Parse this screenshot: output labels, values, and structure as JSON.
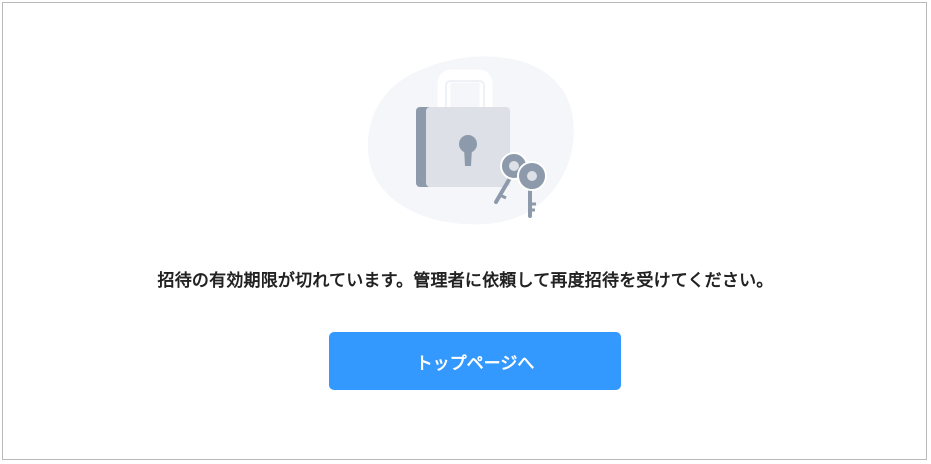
{
  "message": "招待の有効期限が切れています。管理者に依頼して再度招待を受けてください。",
  "button": {
    "label": "トップページへ"
  },
  "illustration": {
    "icons": [
      "lock-icon",
      "keys-icon"
    ],
    "colors": {
      "blob": "#f4f6f9",
      "lock_body": "#dde1e7",
      "lock_shade": "#8d9aab",
      "shackle": "#ffffff",
      "key": "#8d9aab"
    }
  },
  "colors": {
    "button_background": "#3399ff",
    "button_text": "#ffffff",
    "message_text": "#222222",
    "border": "#b9b9b9"
  }
}
